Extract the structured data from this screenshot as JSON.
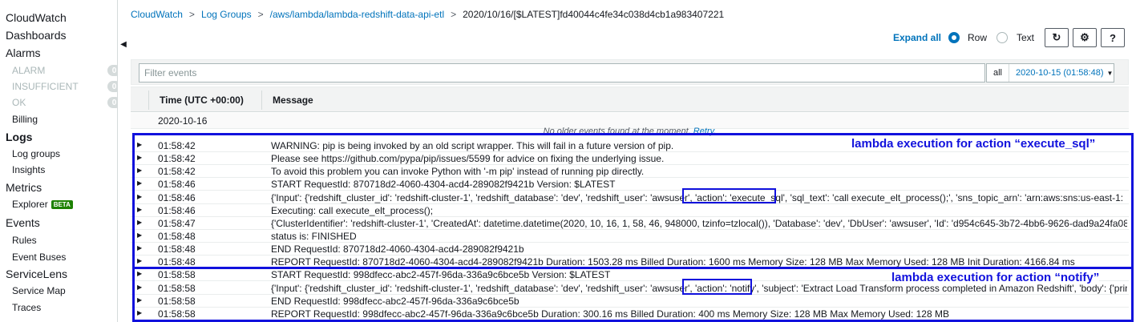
{
  "sidebar": {
    "items": [
      {
        "label": "CloudWatch",
        "level": "top"
      },
      {
        "label": "Dashboards",
        "level": "top"
      },
      {
        "label": "Alarms",
        "level": "top"
      },
      {
        "label": "ALARM",
        "level": "muted",
        "count": "0"
      },
      {
        "label": "INSUFFICIENT",
        "level": "muted",
        "count": "0"
      },
      {
        "label": "OK",
        "level": "muted",
        "count": "0"
      },
      {
        "label": "Billing",
        "level": "sub"
      },
      {
        "label": "Logs",
        "level": "top-bold"
      },
      {
        "label": "Log groups",
        "level": "sub"
      },
      {
        "label": "Insights",
        "level": "sub"
      },
      {
        "label": "Metrics",
        "level": "top"
      },
      {
        "label": "Explorer",
        "level": "sub",
        "badge": "BETA"
      },
      {
        "label": "Events",
        "level": "top"
      },
      {
        "label": "Rules",
        "level": "sub"
      },
      {
        "label": "Event Buses",
        "level": "sub"
      },
      {
        "label": "ServiceLens",
        "level": "top"
      },
      {
        "label": "Service Map",
        "level": "sub"
      },
      {
        "label": "Traces",
        "level": "sub"
      }
    ],
    "collapse_icon": "caret-left-icon"
  },
  "breadcrumb": {
    "items": [
      "CloudWatch",
      "Log Groups",
      "/aws/lambda/lambda-redshift-data-api-etl"
    ],
    "separator": ">",
    "current": "2020/10/16/[$LATEST]fd40044c4fe34c038d4cb1a983407221"
  },
  "toolbar": {
    "expand_all": "Expand all",
    "view_options": [
      {
        "label": "Row",
        "selected": true
      },
      {
        "label": "Text",
        "selected": false
      }
    ],
    "buttons": [
      {
        "name": "refresh-button",
        "icon": "refresh-icon",
        "glyph": "↻"
      },
      {
        "name": "settings-button",
        "icon": "gear-icon",
        "glyph": "⚙"
      },
      {
        "name": "help-button",
        "icon": "help-icon",
        "glyph": "?"
      }
    ]
  },
  "filter": {
    "placeholder": "Filter events",
    "range_all": "all",
    "range_date": "2020-10-15 (01:58:48)"
  },
  "table": {
    "columns": [
      "Time (UTC +00:00)",
      "Message"
    ],
    "date_group": "2020-10-16",
    "no_older": "No older events found at the moment.",
    "retry": "Retry.",
    "rows": [
      {
        "time": "01:58:42",
        "message": "WARNING: pip is being invoked by an old script wrapper. This will fail in a future version of pip."
      },
      {
        "time": "01:58:42",
        "message": "Please see https://github.com/pypa/pip/issues/5599 for advice on fixing the underlying issue."
      },
      {
        "time": "01:58:42",
        "message": "To avoid this problem you can invoke Python with '-m pip' instead of running pip directly."
      },
      {
        "time": "01:58:46",
        "message": "START RequestId: 870718d2-4060-4304-acd4-289082f9421b Version: $LATEST"
      },
      {
        "time": "01:58:46",
        "message": "{'Input': {'redshift_cluster_id': 'redshift-cluster-1', 'redshift_database': 'dev', 'redshift_user': 'awsuser', 'action': 'execute_sql', 'sql_text': 'call execute_elt_process();', 'sns_topic_arn': 'arn:aws:sns:us-east-1:"
      },
      {
        "time": "01:58:46",
        "message": "Executing: call execute_elt_process();"
      },
      {
        "time": "01:58:47",
        "message": "{'ClusterIdentifier': 'redshift-cluster-1', 'CreatedAt': datetime.datetime(2020, 10, 16, 1, 58, 46, 948000, tzinfo=tzlocal()), 'Database': 'dev', 'DbUser': 'awsuser', 'Id': 'd954c645-3b72-4bb6-9626-dad9a24fa085', 'Res"
      },
      {
        "time": "01:58:48",
        "message": "status is: FINISHED"
      },
      {
        "time": "01:58:48",
        "message": "END RequestId: 870718d2-4060-4304-acd4-289082f9421b"
      },
      {
        "time": "01:58:48",
        "message": "REPORT RequestId: 870718d2-4060-4304-acd4-289082f9421b Duration: 1503.28 ms Billed Duration: 1600 ms Memory Size: 128 MB Max Memory Used: 128 MB Init Duration: 4166.84 ms"
      },
      {
        "time": "01:58:58",
        "message": "START RequestId: 998dfecc-abc2-457f-96da-336a9c6bce5b Version: $LATEST"
      },
      {
        "time": "01:58:58",
        "message": "{'Input': {'redshift_cluster_id': 'redshift-cluster-1', 'redshift_database': 'dev', 'redshift_user': 'awsuser', 'action': 'notify', 'subject': 'Extract Load Transform process completed in Amazon Redshift', 'body': {'principal"
      },
      {
        "time": "01:58:58",
        "message": "END RequestId: 998dfecc-abc2-457f-96da-336a9c6bce5b"
      },
      {
        "time": "01:58:58",
        "message": "REPORT RequestId: 998dfecc-abc2-457f-96da-336a9c6bce5b Duration: 300.16 ms Billed Duration: 400 ms Memory Size: 128 MB Max Memory Used: 128 MB"
      }
    ]
  },
  "annotations": {
    "execute_sql": "lambda execution for action “execute_sql”",
    "notify": "lambda execution for action “notify”",
    "color": "#1111dd"
  },
  "colors": {
    "link": "#0073bb",
    "beta": "#1d8102",
    "border": "#d5dbdb"
  }
}
